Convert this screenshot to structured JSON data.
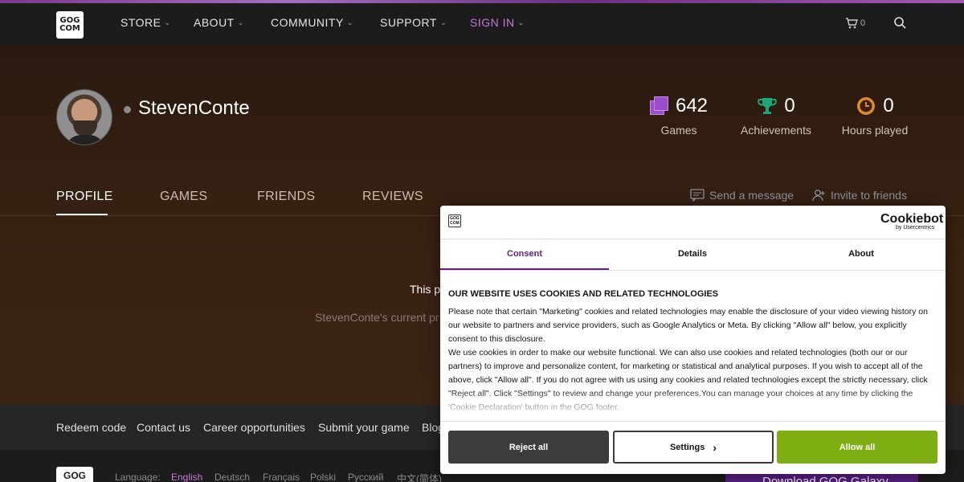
{
  "nav": {
    "logo_top": "GOG",
    "logo_bottom": "COM",
    "items": [
      {
        "label": "STORE"
      },
      {
        "label": "ABOUT"
      },
      {
        "label": "COMMUNITY"
      },
      {
        "label": "SUPPORT"
      },
      {
        "label": "SIGN IN"
      }
    ],
    "cart_count": "0",
    "accent": "#c57ad6"
  },
  "profile": {
    "username": "StevenConte",
    "stats": [
      {
        "value": "642",
        "label": "Games",
        "icon": "games-icon"
      },
      {
        "value": "0",
        "label": "Achievements",
        "icon": "trophy-icon"
      },
      {
        "value": "0",
        "label": "Hours played",
        "icon": "clock-icon"
      }
    ],
    "tabs": [
      "PROFILE",
      "GAMES",
      "FRIENDS",
      "REVIEWS"
    ],
    "actions": {
      "send_message": "Send a message",
      "invite": "Invite to friends"
    },
    "private_title": "This pr",
    "private_sub": "StevenConte's current pr"
  },
  "footer": {
    "links": [
      "Redeem code",
      "Contact us",
      "Career opportunities",
      "Submit your game",
      "Blog"
    ],
    "language_label": "Language:",
    "languages": [
      "English",
      "Deutsch",
      "Français",
      "Polski",
      "Русский",
      "中文(简体)"
    ],
    "galaxy_button": "Download GOG Galaxy"
  },
  "cookie": {
    "brand": "Cookiebot",
    "brand_sub": "by Usercentrics",
    "logo_text": "GOG COM",
    "tabs": [
      "Consent",
      "Details",
      "About"
    ],
    "title": "OUR WEBSITE USES COOKIES AND RELATED TECHNOLOGIES",
    "p1": "Please note that certain \"Marketing\" cookies and related technologies may enable the disclosure of your video viewing history on our website to partners and service providers, such as Google Analytics or Meta. By clicking \"Allow all\" below, you explicitly consent to this disclosure.",
    "p2": "We use cookies in order to make our website functional. We can also use cookies and related technologies (both our or our partners) to improve and personalize content, for marketing or statistical and analytical purposes. If you wish to accept all of the above, click \"Allow all\". If you do not agree with us using any cookies and related technologies except the strictly necessary, click \"Reject all\". Click \"Settings\" to review and change your preferences.You can manage your choices at any time by clicking the 'Cookie Declaration' button in the GOG footer.",
    "buttons": {
      "reject": "Reject all",
      "settings": "Settings",
      "allow": "Allow all"
    },
    "accent": "#6a1b8a",
    "allow_color": "#7fae12"
  }
}
